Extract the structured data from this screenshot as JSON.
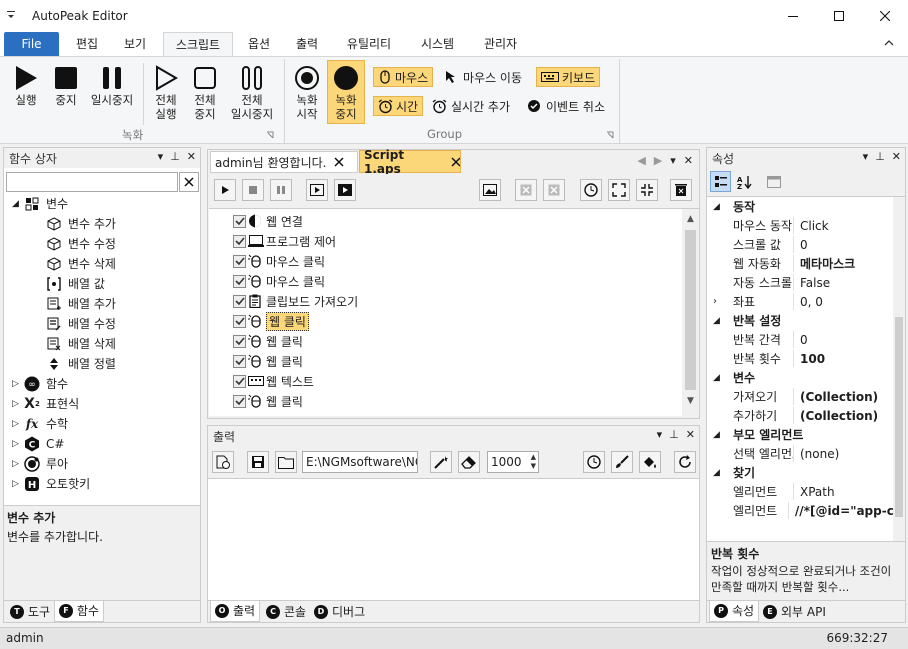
{
  "app": {
    "title": "AutoPeak Editor"
  },
  "ribbon_tabs": [
    "File",
    "편집",
    "보기",
    "스크립트",
    "옵션",
    "출력",
    "유틸리티",
    "시스템",
    "관리자"
  ],
  "ribbon": {
    "run": "실행",
    "stop": "중지",
    "pause": "일시중지",
    "run_all_1": "전체",
    "run_all_2": "실행",
    "stop_all_1": "전체",
    "stop_all_2": "중지",
    "pause_all_1": "전체",
    "pause_all_2": "일시중지",
    "rec_start_1": "녹화",
    "rec_start_2": "시작",
    "rec_stop_1": "녹화",
    "rec_stop_2": "중지",
    "opt_mouse": "마우스",
    "opt_mouse_move": "마우스 이동",
    "opt_keyboard": "키보드",
    "opt_time": "시간",
    "opt_realtime_add": "실시간 추가",
    "opt_event_cancel": "이벤트 취소",
    "group_record": "녹화",
    "group_group": "Group"
  },
  "left_panel": {
    "title": "함수 상자",
    "search_placeholder": "",
    "tree": {
      "variables": "변수",
      "children": [
        "변수 추가",
        "변수 수정",
        "변수 삭제",
        "배열 값",
        "배열 추가",
        "배열 수정",
        "배열 삭제",
        "배열 정렬"
      ],
      "others": [
        "함수",
        "표현식",
        "수학",
        "C#",
        "루아",
        "오토핫키"
      ]
    },
    "desc_title": "변수 추가",
    "desc_text": "변수를 추가합니다.",
    "bottom_tabs": [
      "도구",
      "함수"
    ]
  },
  "doc_tabs": [
    "admin님 환영합니다.",
    "Script 1.aps"
  ],
  "script_items": [
    "웹 연결",
    "프로그램 제어",
    "마우스 클릭",
    "마우스 클릭",
    "클립보드 가져오기",
    "웹 클릭",
    "웹 클릭",
    "웹 클릭",
    "웹 텍스트",
    "웹 클릭"
  ],
  "output": {
    "title": "출력",
    "path": "E:\\NGMsoftware\\NG",
    "count": "1000",
    "bottom_tabs": [
      "출력",
      "콘솔",
      "디버그"
    ]
  },
  "properties": {
    "title": "속성",
    "rows": [
      {
        "cat": true,
        "name": "동작"
      },
      {
        "name": "마우스 동작",
        "value": "Click"
      },
      {
        "name": "스크롤 값",
        "value": "0"
      },
      {
        "name": "웹 자동화",
        "value": "메타마스크",
        "bold": true
      },
      {
        "name": "자동 스크롤",
        "value": "False"
      },
      {
        "name": "좌표",
        "value": "0, 0",
        "expand": true
      },
      {
        "cat": true,
        "name": "반복 설정"
      },
      {
        "name": "반복 간격",
        "value": "0"
      },
      {
        "name": "반복 횟수",
        "value": "100",
        "bold": true
      },
      {
        "cat": true,
        "name": "변수"
      },
      {
        "name": "가져오기",
        "value": "(Collection)",
        "bold": true
      },
      {
        "name": "추가하기",
        "value": "(Collection)",
        "bold": true
      },
      {
        "cat": true,
        "name": "부모 엘리먼트"
      },
      {
        "name": "선택 엘리먼트",
        "value": "(none)"
      },
      {
        "cat": true,
        "name": "찾기"
      },
      {
        "name": "엘리먼트",
        "value": "XPath"
      },
      {
        "name": "엘리먼트",
        "value": "//*[@id=\"app-co",
        "bold": true
      }
    ],
    "desc_title": "반복 횟수",
    "desc_text": "작업이 정상적으로 완료되거나 조건이 만족할 때까지 반복할 횟수...",
    "bottom_tabs": [
      "속성",
      "외부 API"
    ]
  },
  "status": {
    "user": "admin",
    "time": "669:32:27"
  },
  "colors": {
    "accent": "#2b6fc0",
    "highlight": "#fcd779",
    "selection": "#c6dcf3"
  }
}
